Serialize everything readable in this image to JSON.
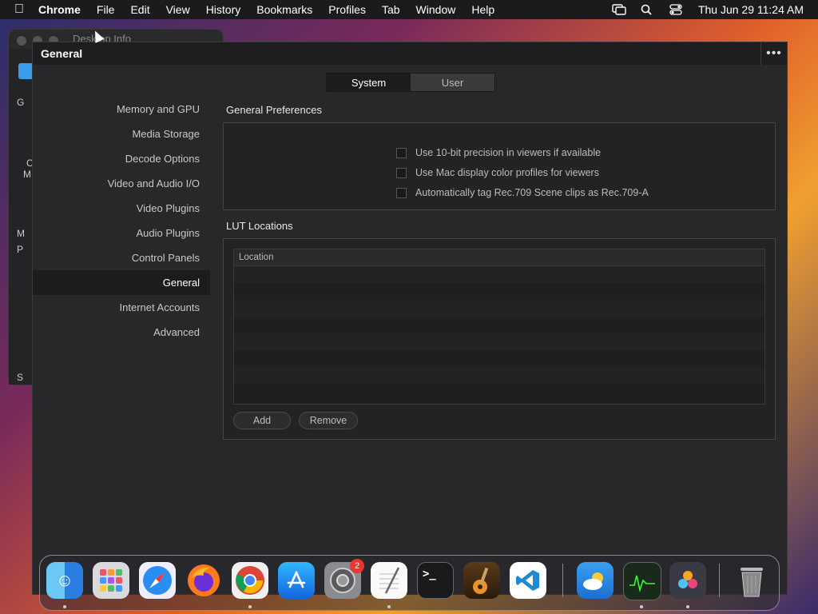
{
  "menubar": {
    "app_name": "Chrome",
    "items": [
      "File",
      "Edit",
      "View",
      "History",
      "Bookmarks",
      "Profiles",
      "Tab",
      "Window",
      "Help"
    ],
    "clock": "Thu Jun 29  11:24 AM"
  },
  "background_window": {
    "title": "Desktop Info",
    "sidebar_chars": [
      "G",
      "C",
      "M",
      "M",
      "P",
      "S"
    ]
  },
  "window": {
    "title": "General",
    "tabs": [
      "System",
      "User"
    ],
    "active_tab": "System",
    "nav": [
      "Memory and GPU",
      "Media Storage",
      "Decode Options",
      "Video and Audio I/O",
      "Video Plugins",
      "Audio Plugins",
      "Control Panels",
      "General",
      "Internet Accounts",
      "Advanced"
    ],
    "active_nav": "General",
    "general_prefs": {
      "title": "General Preferences",
      "options": [
        {
          "label": "Use 10-bit precision in viewers if available",
          "checked": false
        },
        {
          "label": "Use Mac display color profiles for viewers",
          "checked": false
        },
        {
          "label": "Automatically tag Rec.709 Scene clips as Rec.709-A",
          "checked": false
        }
      ]
    },
    "lut": {
      "title": "LUT Locations",
      "column": "Location",
      "add_label": "Add",
      "remove_label": "Remove"
    }
  },
  "dock": {
    "apps": [
      "Finder",
      "Launchpad",
      "Safari",
      "Firefox",
      "Chrome",
      "App Store",
      "System Settings",
      "TextEdit",
      "Terminal",
      "GarageBand",
      "Visual Studio Code",
      "Weather",
      "Activity Monitor",
      "DaVinci Resolve",
      "Trash"
    ],
    "settings_badge": "2"
  }
}
